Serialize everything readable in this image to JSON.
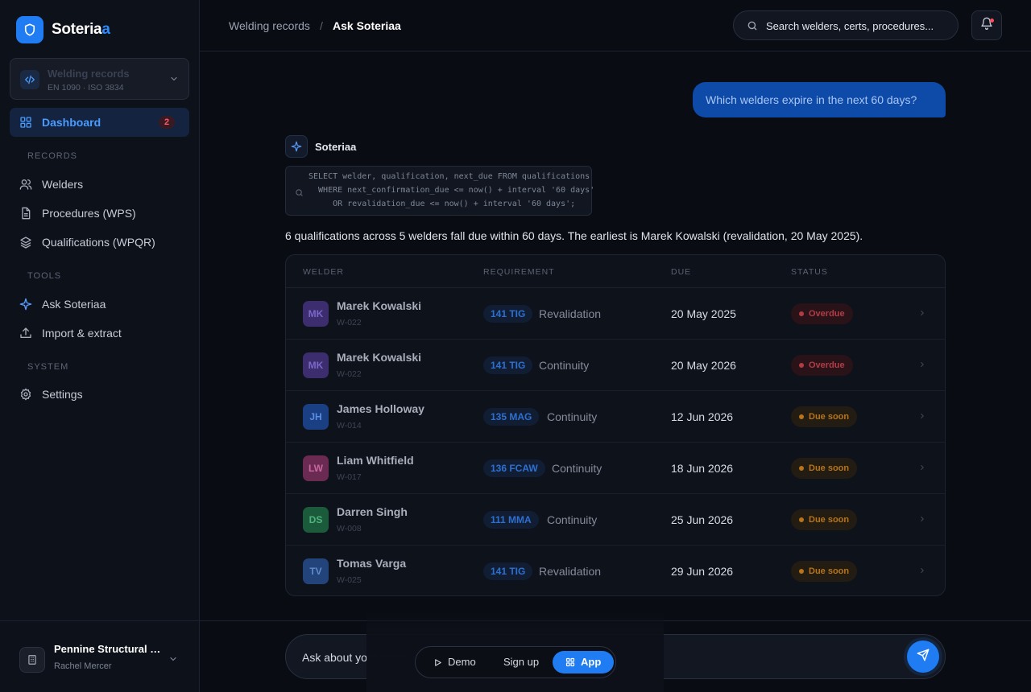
{
  "brand": {
    "name_main": "Soteria",
    "name_accent": "a"
  },
  "workspace": {
    "name": "Welding records",
    "subtitle": "EN 1090 · ISO 3834"
  },
  "nav": {
    "dashboard": {
      "label": "Dashboard",
      "badge": "2"
    },
    "records_label": "RECORDS",
    "welders": "Welders",
    "procedures": "Procedures (WPS)",
    "qualifications": "Qualifications (WPQR)",
    "tools_label": "TOOLS",
    "ask": "Ask Soteriaa",
    "import": "Import & extract",
    "system_label": "SYSTEM",
    "settings": "Settings"
  },
  "account": {
    "org": "Pennine Structural Steel",
    "user": "Rachel Mercer"
  },
  "breadcrumb": {
    "parent": "Welding records",
    "separator": "/",
    "current": "Ask Soteriaa"
  },
  "search": {
    "placeholder": "Search welders, certs, procedures..."
  },
  "chat": {
    "user_message": "Which welders expire in the next 60 days?",
    "assistant_name": "Soteriaa",
    "sql": [
      "SELECT welder, qualification, next_due FROM qualifications",
      "  WHERE next_confirmation_due <= now() + interval '60 days'",
      "     OR revalidation_due <= now() + interval '60 days';"
    ],
    "answer": "6 qualifications across 5 welders fall due within 60 days. The earliest is Marek Kowalski (revalidation, 20 May 2025)."
  },
  "table": {
    "headers": {
      "welder": "WELDER",
      "requirement": "REQUIREMENT",
      "due": "DUE",
      "status": "STATUS"
    },
    "rows": [
      {
        "initials": "MK",
        "name": "Marek Kowalski",
        "id": "W-022",
        "process": "141 TIG",
        "requirement": "Revalidation",
        "due": "20 May 2025",
        "status": "Overdue",
        "status_kind": "overdue",
        "avatar_bg": "#3b2d6e",
        "avatar_fg": "#7d66c9"
      },
      {
        "initials": "MK",
        "name": "Marek Kowalski",
        "id": "W-022",
        "process": "141 TIG",
        "requirement": "Continuity",
        "due": "20 May 2026",
        "status": "Overdue",
        "status_kind": "overdue",
        "avatar_bg": "#3b2d6e",
        "avatar_fg": "#7d66c9"
      },
      {
        "initials": "JH",
        "name": "James Holloway",
        "id": "W-014",
        "process": "135 MAG",
        "requirement": "Continuity",
        "due": "12 Jun 2026",
        "status": "Due soon",
        "status_kind": "soon",
        "avatar_bg": "#1a3f82",
        "avatar_fg": "#5a8ee0"
      },
      {
        "initials": "LW",
        "name": "Liam Whitfield",
        "id": "W-017",
        "process": "136 FCAW",
        "requirement": "Continuity",
        "due": "18 Jun 2026",
        "status": "Due soon",
        "status_kind": "soon",
        "avatar_bg": "#6b2a52",
        "avatar_fg": "#c7679f"
      },
      {
        "initials": "DS",
        "name": "Darren Singh",
        "id": "W-008",
        "process": "111 MMA",
        "requirement": "Continuity",
        "due": "25 Jun 2026",
        "status": "Due soon",
        "status_kind": "soon",
        "avatar_bg": "#1b5b3c",
        "avatar_fg": "#4fb27d"
      },
      {
        "initials": "TV",
        "name": "Tomas Varga",
        "id": "W-025",
        "process": "141 TIG",
        "requirement": "Revalidation",
        "due": "29 Jun 2026",
        "status": "Due soon",
        "status_kind": "soon",
        "avatar_bg": "#22447a",
        "avatar_fg": "#5f8acb"
      }
    ]
  },
  "composer": {
    "placeholder": "Ask about your records..."
  },
  "switcher": {
    "demo": "Demo",
    "signup": "Sign up",
    "app": "App"
  }
}
